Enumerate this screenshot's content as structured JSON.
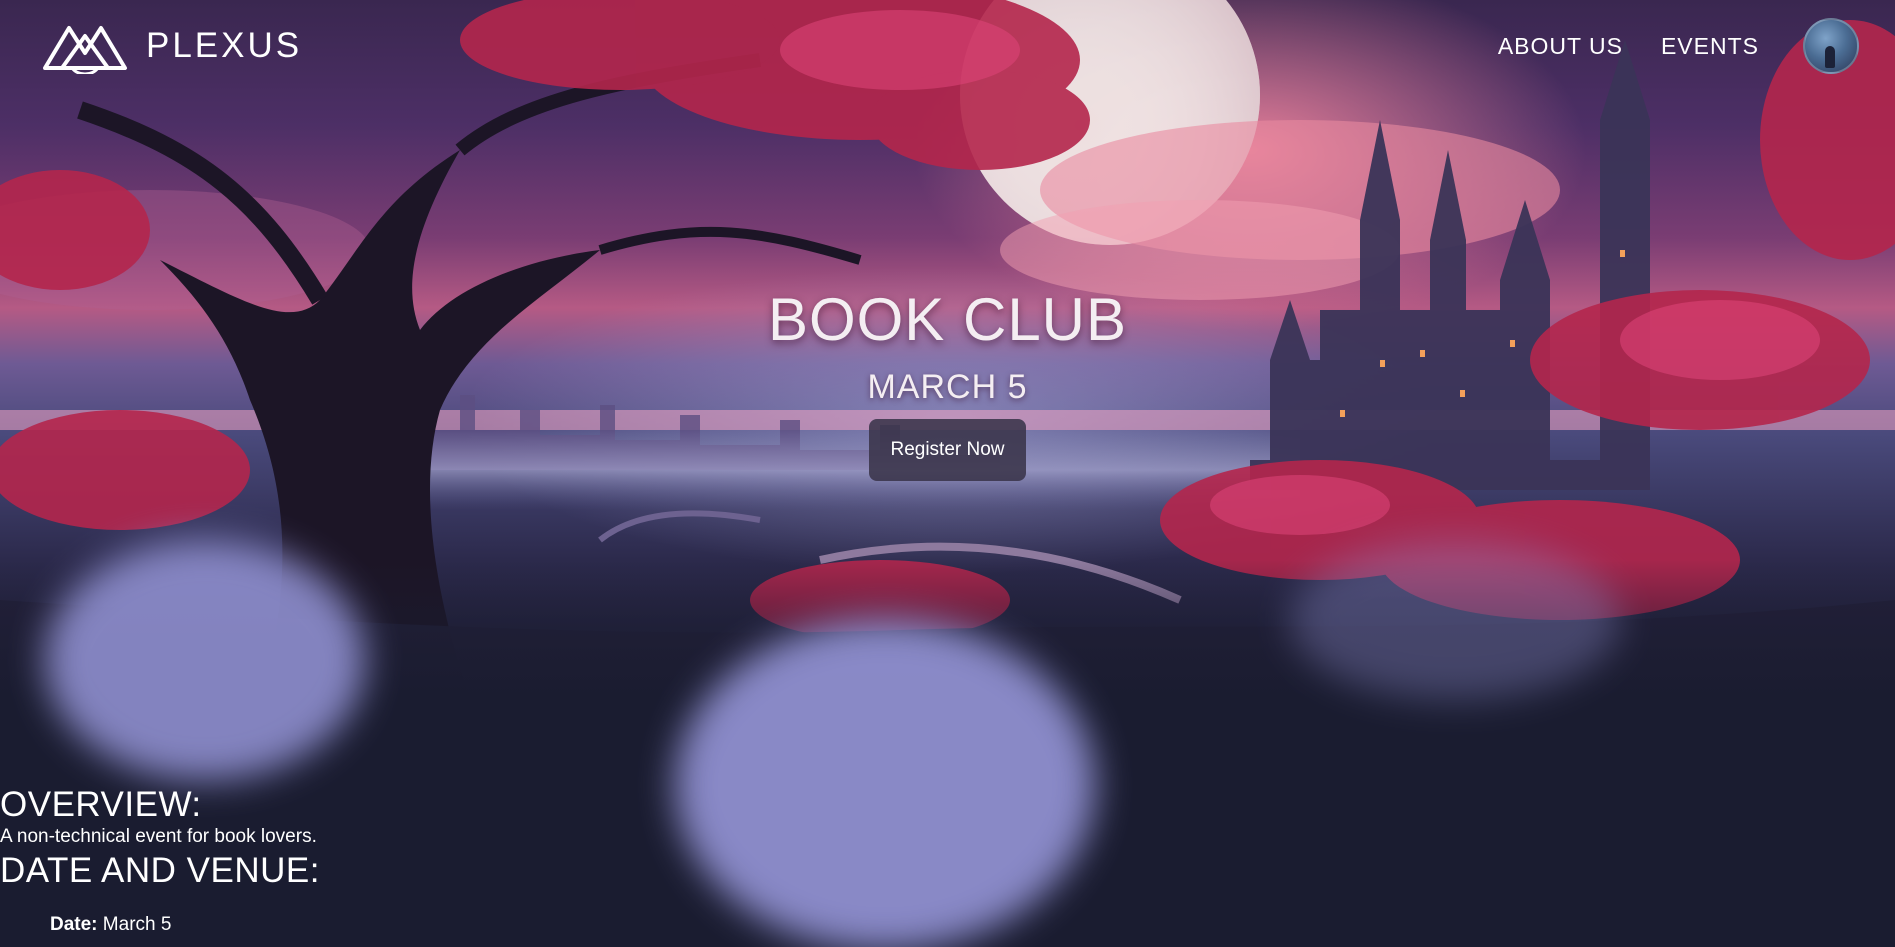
{
  "brand": {
    "name": "PLEXUS",
    "logo_icon": "plexus-mountain-logo"
  },
  "nav": {
    "links": [
      {
        "label": "ABOUT US"
      },
      {
        "label": "EVENTS"
      }
    ],
    "avatar_icon": "user-avatar"
  },
  "hero": {
    "title": "BOOK CLUB",
    "date": "MARCH 5",
    "register_label": "Register Now"
  },
  "overview": {
    "heading": "OVERVIEW:",
    "text": "A non-technical event for book lovers."
  },
  "date_venue": {
    "heading": "DATE AND VENUE:",
    "items": [
      {
        "label": "Date:",
        "value": "March 5"
      }
    ]
  },
  "colors": {
    "page_background": "#1a1c30",
    "glow_blob": "#8f8fcf",
    "button_background": "#3a344a",
    "text": "#ffffff"
  }
}
